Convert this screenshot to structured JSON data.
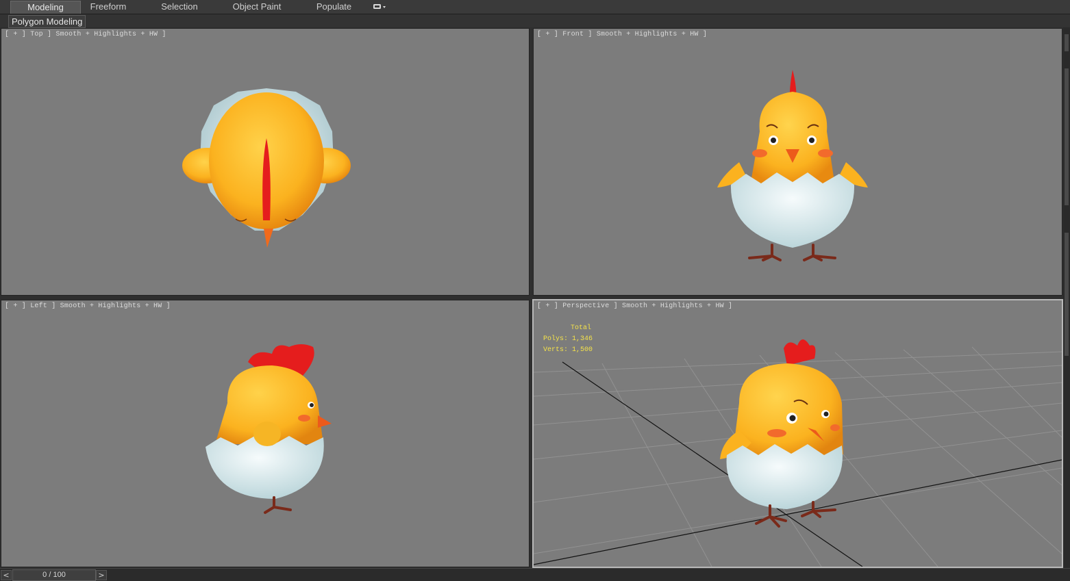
{
  "ribbon": {
    "tabs": [
      "Modeling",
      "Freeform",
      "Selection",
      "Object Paint",
      "Populate"
    ],
    "active_tab": "Modeling",
    "panel_label": "Polygon Modeling"
  },
  "viewports": {
    "top": {
      "label": "[ + ] Top ] Smooth + Highlights + HW ]"
    },
    "front": {
      "label": "[ + ] Front ] Smooth + Highlights + HW ]"
    },
    "left": {
      "label": "[ + ] Left ] Smooth + Highlights + HW ]"
    },
    "perspective": {
      "label": "[ + ] Perspective ] Smooth + Highlights + HW ]"
    }
  },
  "stats": {
    "title": "Total",
    "polys": "Polys: 1,346",
    "verts": "Verts: 1,500"
  },
  "timeline": {
    "prev": "<",
    "next": ">",
    "frame": "0 / 100"
  },
  "colors": {
    "viewport_bg": "#7c7c7c",
    "body_yellow": "#fbb21f",
    "comb_red": "#e51d1d",
    "shell_white": "#e4f0f2",
    "stats_yellow": "#f4e24a"
  }
}
